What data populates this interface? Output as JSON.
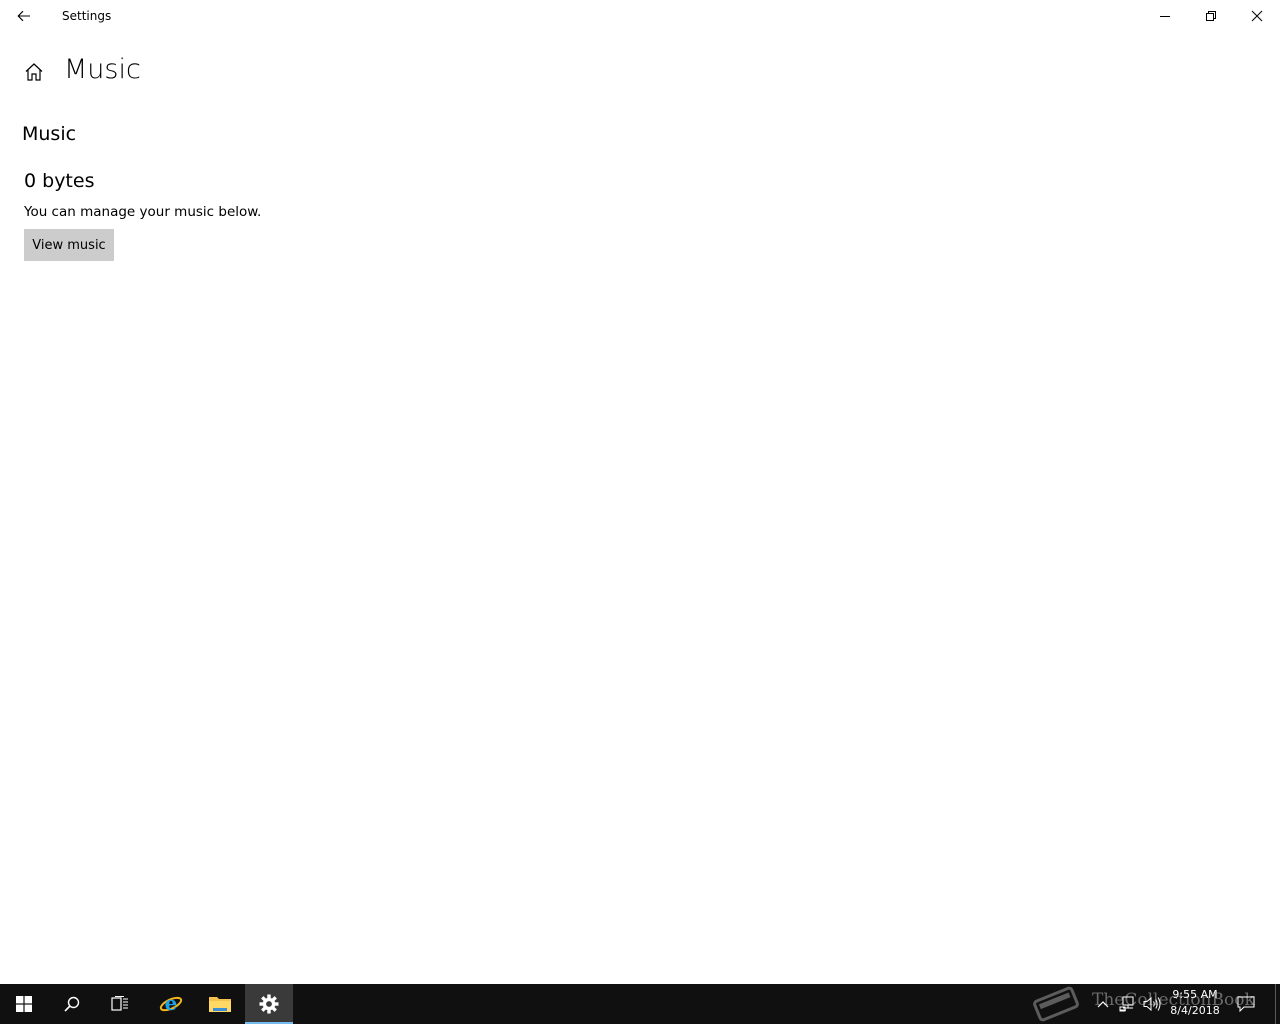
{
  "window": {
    "title": "Settings",
    "back_icon": "back-arrow-icon",
    "minimize_icon": "minimize-icon",
    "maximize_icon": "restore-icon",
    "close_icon": "close-icon"
  },
  "page": {
    "home_icon": "home-icon",
    "title": "Music",
    "section_title": "Music",
    "size": "0 bytes",
    "description": "You can manage your music below.",
    "view_button_label": "View music"
  },
  "taskbar": {
    "items": [
      {
        "name": "start",
        "icon": "windows-logo-icon"
      },
      {
        "name": "search",
        "icon": "search-icon"
      },
      {
        "name": "task-view",
        "icon": "task-view-icon"
      },
      {
        "name": "internet-explorer",
        "icon": "internet-explorer-icon"
      },
      {
        "name": "file-explorer",
        "icon": "folder-icon"
      },
      {
        "name": "settings",
        "icon": "gear-icon",
        "active": true
      }
    ],
    "watermark": "TheCollectionBook",
    "tray": {
      "time": "9:55 AM",
      "date": "8/4/2018"
    }
  },
  "colors": {
    "taskbar_bg": "#101010",
    "active_indicator": "#76b9ed",
    "button_bg": "#cccccc"
  }
}
